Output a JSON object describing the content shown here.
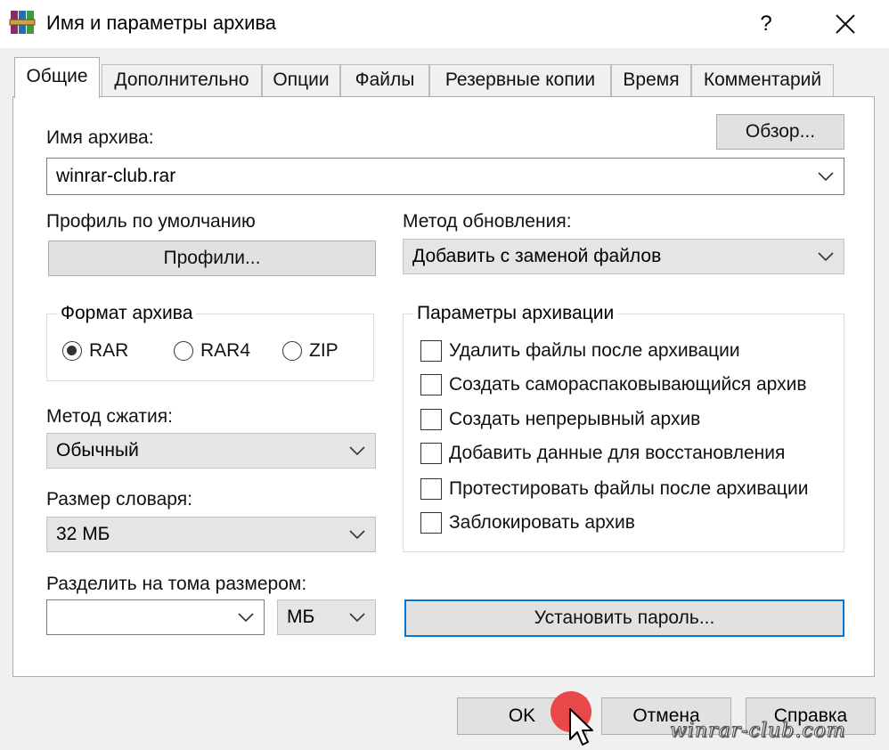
{
  "window": {
    "title": "Имя и параметры архива",
    "help": "?"
  },
  "tabs": [
    {
      "label": "Общие"
    },
    {
      "label": "Дополнительно"
    },
    {
      "label": "Опции"
    },
    {
      "label": "Файлы"
    },
    {
      "label": "Резервные копии"
    },
    {
      "label": "Время"
    },
    {
      "label": "Комментарий"
    }
  ],
  "archive_name": {
    "label": "Имя архива:",
    "value": "winrar-club.rar",
    "browse": "Обзор..."
  },
  "profile": {
    "label": "Профиль по умолчанию",
    "button": "Профили..."
  },
  "update_method": {
    "label": "Метод обновления:",
    "value": "Добавить с заменой файлов"
  },
  "format": {
    "title": "Формат архива",
    "options": [
      {
        "label": "RAR",
        "selected": true
      },
      {
        "label": "RAR4",
        "selected": false
      },
      {
        "label": "ZIP",
        "selected": false
      }
    ]
  },
  "compression": {
    "label": "Метод сжатия:",
    "value": "Обычный"
  },
  "dictionary": {
    "label": "Размер словаря:",
    "value": "32 МБ"
  },
  "split": {
    "label": "Разделить на тома размером:",
    "value": "",
    "unit": "МБ"
  },
  "options": {
    "title": "Параметры архивации",
    "items": [
      {
        "label": "Удалить файлы после архивации",
        "checked": false
      },
      {
        "label": "Создать самораспаковывающийся архив",
        "checked": false
      },
      {
        "label": "Создать непрерывный архив",
        "checked": false
      },
      {
        "label": "Добавить данные для восстановления",
        "checked": false
      },
      {
        "label": "Протестировать файлы после архивации",
        "checked": false
      },
      {
        "label": "Заблокировать архив",
        "checked": false
      }
    ]
  },
  "password_button": "Установить пароль...",
  "footer": {
    "ok": "OK",
    "cancel": "Отмена",
    "help": "Справка"
  },
  "watermark": "winrar-club.com",
  "colors": {
    "accent": "#0078d7",
    "cursor_highlight": "#e94848"
  }
}
